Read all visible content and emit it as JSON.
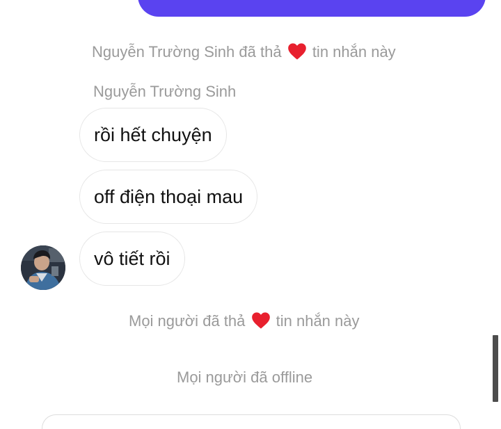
{
  "conversation": {
    "reaction_1": {
      "actor": "Nguyễn Trường Sinh",
      "before": "đã thả",
      "after": "tin nhắn này",
      "emoji": "heart-icon"
    },
    "sender_name": "Nguyễn Trường Sinh",
    "messages": [
      {
        "text": "rồi hết chuyện"
      },
      {
        "text": "off điện thoại mau"
      },
      {
        "text": "vô tiết rồi"
      }
    ],
    "reaction_2": {
      "actor": "Mọi người",
      "before": "đã thả",
      "after": "tin nhắn này",
      "emoji": "heart-icon"
    },
    "status": "Mọi người đã offline"
  },
  "colors": {
    "accent": "#5a43f0",
    "heart": "#e8202e",
    "muted_text": "#9a9a9a"
  }
}
